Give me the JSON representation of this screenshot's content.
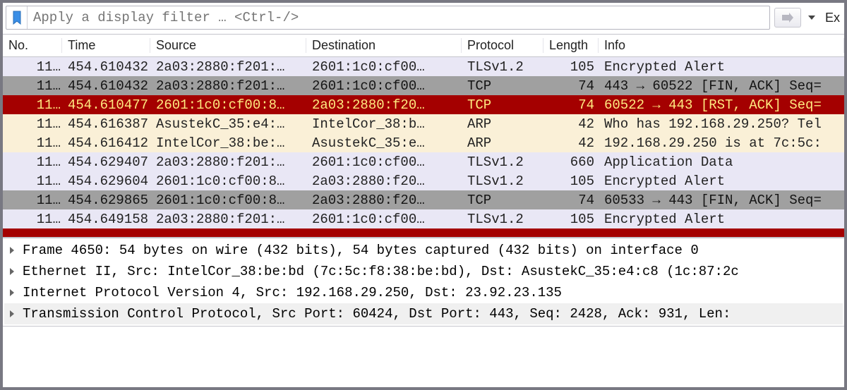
{
  "toolbar": {
    "filter_placeholder": "Apply a display filter … <Ctrl-/>",
    "expr_label": "Ex"
  },
  "columns": {
    "no": "No.",
    "time": "Time",
    "source": "Source",
    "destination": "Destination",
    "protocol": "Protocol",
    "length": "Length",
    "info": "Info"
  },
  "rows": [
    {
      "cls": "c-lav",
      "no": "11…",
      "time": "454.610432",
      "src": "2a03:2880:f201:…",
      "dst": "2601:1c0:cf00…",
      "proto": "TLSv1.2",
      "len": "105",
      "info": "Encrypted Alert"
    },
    {
      "cls": "c-gray",
      "no": "11…",
      "time": "454.610432",
      "src": "2a03:2880:f201:…",
      "dst": "2601:1c0:cf00…",
      "proto": "TCP",
      "len": "74",
      "info": "443 → 60522 [FIN, ACK] Seq="
    },
    {
      "cls": "c-red",
      "no": "11…",
      "time": "454.610477",
      "src": "2601:1c0:cf00:8…",
      "dst": "2a03:2880:f20…",
      "proto": "TCP",
      "len": "74",
      "info": "60522 → 443 [RST, ACK] Seq="
    },
    {
      "cls": "c-crm",
      "no": "11…",
      "time": "454.616387",
      "src": "AsustekC_35:e4:…",
      "dst": "IntelCor_38:b…",
      "proto": "ARP",
      "len": "42",
      "info": "Who has 192.168.29.250? Tel"
    },
    {
      "cls": "c-crm",
      "no": "11…",
      "time": "454.616412",
      "src": "IntelCor_38:be:…",
      "dst": "AsustekC_35:e…",
      "proto": "ARP",
      "len": "42",
      "info": "192.168.29.250 is at 7c:5c:"
    },
    {
      "cls": "c-lav",
      "no": "11…",
      "time": "454.629407",
      "src": "2a03:2880:f201:…",
      "dst": "2601:1c0:cf00…",
      "proto": "TLSv1.2",
      "len": "660",
      "info": "Application Data"
    },
    {
      "cls": "c-lav",
      "no": "11…",
      "time": "454.629604",
      "src": "2601:1c0:cf00:8…",
      "dst": "2a03:2880:f20…",
      "proto": "TLSv1.2",
      "len": "105",
      "info": "Encrypted Alert"
    },
    {
      "cls": "c-gray",
      "no": "11…",
      "time": "454.629865",
      "src": "2601:1c0:cf00:8…",
      "dst": "2a03:2880:f20…",
      "proto": "TCP",
      "len": "74",
      "info": "60533 → 443 [FIN, ACK] Seq="
    },
    {
      "cls": "c-lav",
      "no": "11…",
      "time": "454.649158",
      "src": "2a03:2880:f201:…",
      "dst": "2601:1c0:cf00…",
      "proto": "TLSv1.2",
      "len": "105",
      "info": "Encrypted Alert"
    }
  ],
  "details": {
    "l0": "Frame 4650: 54 bytes on wire (432 bits), 54 bytes captured (432 bits) on interface 0",
    "l1": "Ethernet II, Src: IntelCor_38:be:bd (7c:5c:f8:38:be:bd), Dst: AsustekC_35:e4:c8 (1c:87:2c",
    "l2": "Internet Protocol Version 4, Src: 192.168.29.250, Dst: 23.92.23.135",
    "l3": "Transmission Control Protocol, Src Port: 60424, Dst Port: 443, Seq: 2428, Ack: 931, Len: "
  }
}
